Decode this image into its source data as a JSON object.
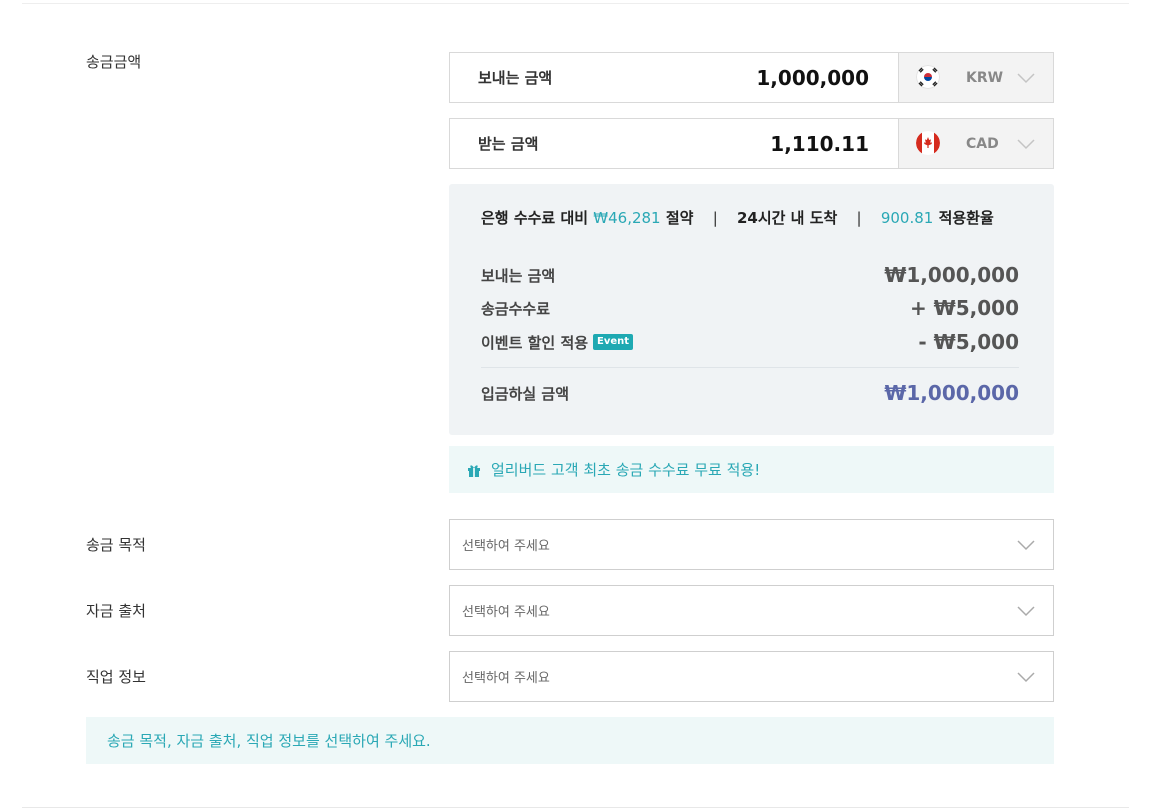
{
  "remit": {
    "section_label": "송금금액",
    "send": {
      "label": "보내는 금액",
      "amount": "1,000,000",
      "currency": "KRW",
      "flag_icon": "korea-flag-icon"
    },
    "receive": {
      "label": "받는 금액",
      "amount": "1,110.11",
      "currency": "CAD",
      "flag_icon": "canada-flag-icon"
    }
  },
  "summary": {
    "headline": {
      "savings_prefix": "은행 수수료 대비",
      "savings_amount": "₩46,281",
      "savings_suffix": "절약",
      "separator": "|",
      "arrival": "24시간 내 도착",
      "rate_value": "900.81",
      "rate_label": "적용환율"
    },
    "lines": [
      {
        "label": "보내는 금액",
        "value": "₩1,000,000"
      },
      {
        "label": "송금수수료",
        "value": "+ ₩5,000"
      },
      {
        "label": "이벤트 할인 적용",
        "badge": "Event",
        "value": "- ₩5,000"
      }
    ],
    "total": {
      "label": "입금하실 금액",
      "value": "₩1,000,000"
    }
  },
  "promo": {
    "icon": "gift-icon",
    "text": "얼리버드 고객 최초 송금 수수료 무료 적용!"
  },
  "fields": [
    {
      "label": "송금 목적",
      "placeholder": "선택하여 주세요"
    },
    {
      "label": "자금 출처",
      "placeholder": "선택하여 주세요"
    },
    {
      "label": "직업 정보",
      "placeholder": "선택하여 주세요"
    }
  ],
  "notice": "송금 목적, 자금 출처, 직업 정보를 선택하여 주세요.",
  "colors": {
    "accent_teal": "#2aa8b5",
    "total_purple": "#5b67a8",
    "badge_teal": "#1ea9b2"
  }
}
